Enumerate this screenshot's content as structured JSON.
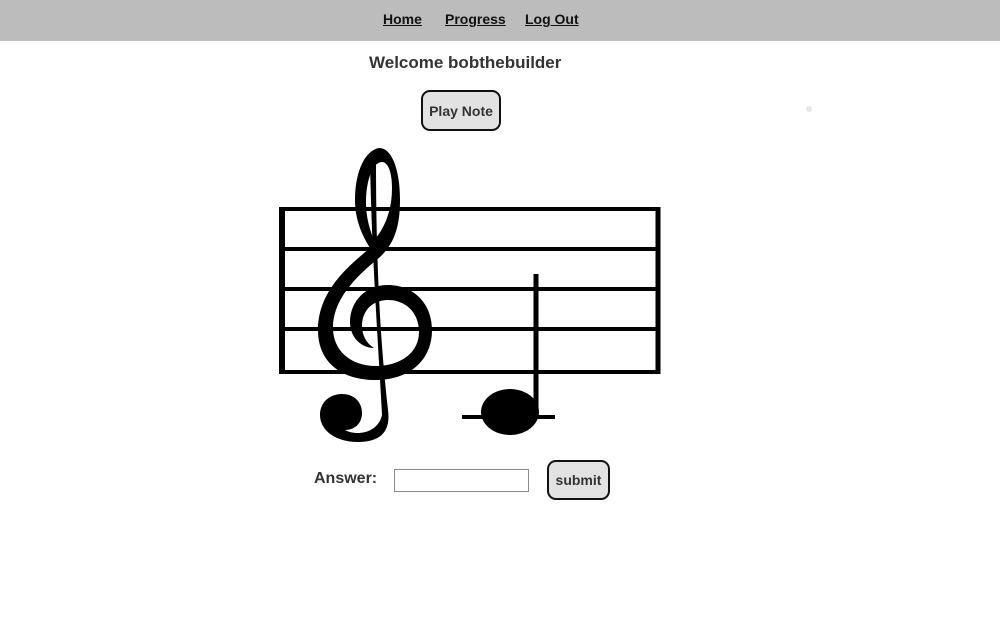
{
  "nav": {
    "home": "Home",
    "progress": "Progress",
    "logout": "Log Out"
  },
  "welcome": {
    "text": "Welcome bobthebuilder"
  },
  "controls": {
    "play_label": "Play Note"
  },
  "notation": {
    "clef": "treble-clef-icon",
    "note": "quarter-note-icon",
    "ledger_line": true
  },
  "answer": {
    "label": "Answer:",
    "value": "",
    "placeholder": "",
    "submit_label": "submit"
  },
  "colors": {
    "navbar": "#bcbcbc",
    "button_bg": "#e2e2e2",
    "text": "#333333"
  }
}
